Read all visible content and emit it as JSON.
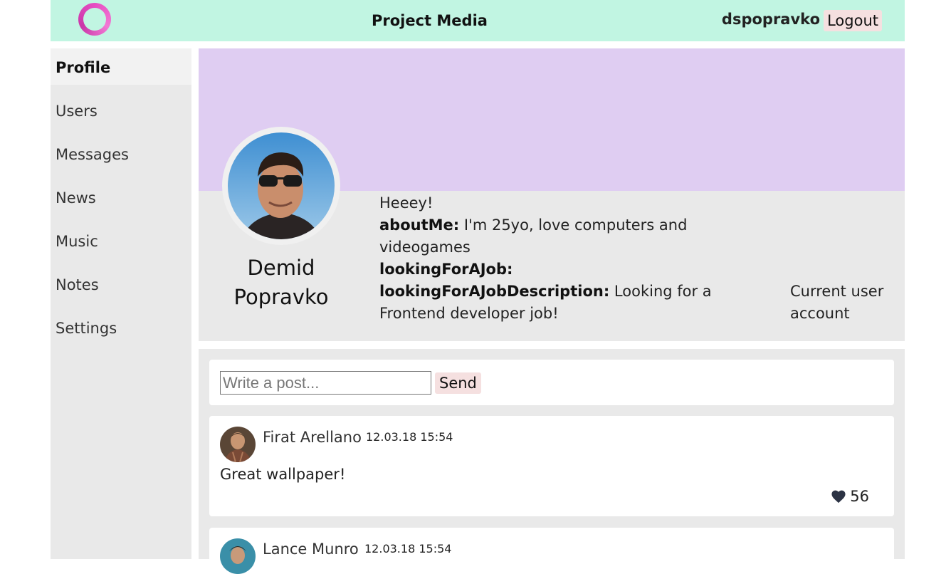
{
  "header": {
    "logo_icon": "ring-logo-icon",
    "app_title": "Project Media",
    "username": "dspopravko",
    "logout_label": "Logout"
  },
  "sidebar": {
    "items": [
      {
        "label": "Profile",
        "active": true
      },
      {
        "label": "Users"
      },
      {
        "label": "Messages"
      },
      {
        "label": "News"
      },
      {
        "label": "Music"
      },
      {
        "label": "Notes"
      },
      {
        "label": "Settings"
      }
    ]
  },
  "profile": {
    "name": "Demid Popravko",
    "status": "Heeey!",
    "about_me_key": "aboutMe:",
    "about_me_value": "I'm 25yo, love computers and videogames",
    "looking_for_job_key": "lookingForAJob:",
    "looking_for_job_desc_key": "lookingForAJobDescription:",
    "looking_for_job_desc_value": "Looking for a Frontend developer job!",
    "current_user_note": "Current user account"
  },
  "new_post": {
    "placeholder": "Write a post...",
    "send_label": "Send"
  },
  "posts": [
    {
      "author": "Firat Arellano",
      "time": "12.03.18 15:54",
      "text": "Great wallpaper!",
      "likes": "56"
    },
    {
      "author": "Lance Munro",
      "time": "12.03.18 15:54"
    }
  ],
  "colors": {
    "header_bg": "#c1f5e2",
    "cover_bg": "#dfcdf2",
    "panel_bg": "#e9e9e9",
    "button_bg": "#f5e0e0",
    "logo_accent": "#e64ec2"
  }
}
